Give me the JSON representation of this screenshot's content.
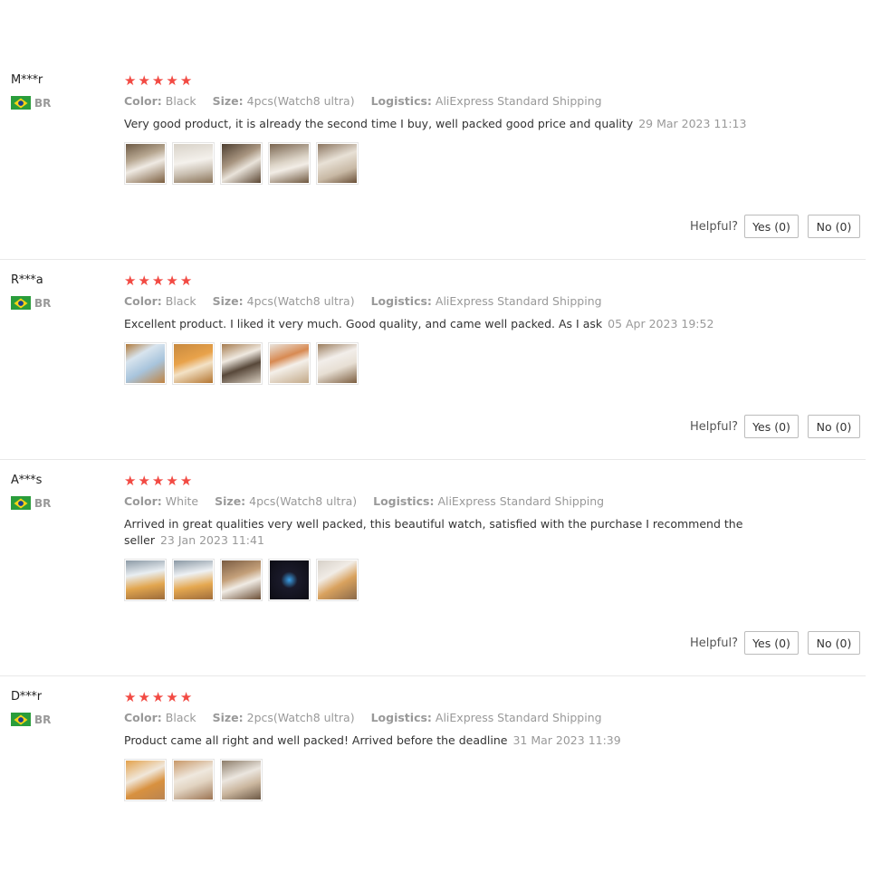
{
  "labels": {
    "color": "Color:",
    "size": "Size:",
    "logistics": "Logistics:",
    "helpful": "Helpful?"
  },
  "icons": {
    "star": "star-icon",
    "flag": "brazil-flag-icon"
  },
  "colors": {
    "star": "#f24a43",
    "muted": "#999999",
    "text": "#333333"
  },
  "reviews": [
    {
      "user": "M***r",
      "country": "BR",
      "rating": 5,
      "color": "Black",
      "size": "4pcs(Watch8 ultra)",
      "logistics": "AliExpress Standard Shipping",
      "text": "Very good product, it is already the second time I buy, well packed good price and quality",
      "date": "29 Mar 2023 11:13",
      "yes": "Yes (0)",
      "no": "No (0)"
    },
    {
      "user": "R***a",
      "country": "BR",
      "rating": 5,
      "color": "Black",
      "size": "4pcs(Watch8 ultra)",
      "logistics": "AliExpress Standard Shipping",
      "text": "Excellent product. I liked it very much. Good quality, and came well packed. As I ask",
      "date": "05 Apr 2023 19:52",
      "yes": "Yes (0)",
      "no": "No (0)"
    },
    {
      "user": "A***s",
      "country": "BR",
      "rating": 5,
      "color": "White",
      "size": "4pcs(Watch8 ultra)",
      "logistics": "AliExpress Standard Shipping",
      "text": "Arrived in great qualities very well packed, this beautiful watch, satisfied with the purchase I recommend the seller",
      "date": "23 Jan 2023 11:41",
      "yes": "Yes (0)",
      "no": "No (0)"
    },
    {
      "user": "D***r",
      "country": "BR",
      "rating": 5,
      "color": "Black",
      "size": "2pcs(Watch8 ultra)",
      "logistics": "AliExpress Standard Shipping",
      "text": "Product came all right and well packed! Arrived before the deadline",
      "date": "31 Mar 2023 11:39"
    }
  ]
}
